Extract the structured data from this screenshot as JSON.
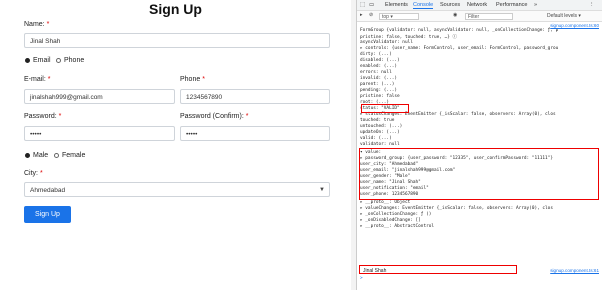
{
  "form": {
    "title": "Sign Up",
    "name_label": "Name:",
    "name_value": "Jinal Shah",
    "notify_email": "Email",
    "notify_phone": "Phone",
    "email_label": "E-mail:",
    "email_value": "jinalshah999@gmail.com",
    "phone_label": "Phone",
    "phone_value": "1234567890",
    "password_label": "Password:",
    "password_value": "•••••",
    "confirm_label": "Password (Confirm):",
    "confirm_value": "•••••",
    "gender_male": "Male",
    "gender_female": "Female",
    "city_label": "City:",
    "city_value": "Ahmedabad",
    "submit": "Sign Up",
    "required_mark": "*"
  },
  "devtools": {
    "tabs": [
      "Elements",
      "Console",
      "Sources",
      "Network",
      "Performance"
    ],
    "context": "top",
    "filter_placeholder": "Filter",
    "levels": "Default levels ▾",
    "lines": [
      {
        "text": "FormGroup {validator: null, asyncValidator: null, _onCollectionChange: ƒ, p",
        "src": "signup.component.ts:60"
      },
      {
        "text": "  pristine: false, touched: true, …} ⓘ",
        "src": ""
      },
      {
        "text": "  asyncValidator: null",
        "src": ""
      },
      {
        "text": "▸ controls: {user_name: FormControl, user_email: FormControl, password_grou",
        "src": ""
      },
      {
        "text": "  dirty: (...)",
        "src": ""
      },
      {
        "text": "  disabled: (...)",
        "src": ""
      },
      {
        "text": "  enabled: (...)",
        "src": ""
      },
      {
        "text": "  errors: null",
        "src": ""
      },
      {
        "text": "  invalid: (...)",
        "src": ""
      },
      {
        "text": "  parent: (...)",
        "src": ""
      },
      {
        "text": "  pending: (...)",
        "src": ""
      },
      {
        "text": "  pristine: false",
        "src": ""
      },
      {
        "text": "  root: (...)",
        "src": ""
      },
      {
        "text": "  status: \"VALID\"",
        "src": ""
      },
      {
        "text": "▸ statusChanges: EventEmitter {_isScalar: false, observers: Array(0), clos",
        "src": ""
      },
      {
        "text": "  touched: true",
        "src": ""
      },
      {
        "text": "  untouched: (...)",
        "src": ""
      },
      {
        "text": "  updateOn: (...)",
        "src": ""
      },
      {
        "text": "  valid: (...)",
        "src": ""
      },
      {
        "text": "  validator: null",
        "src": ""
      },
      {
        "text": "▾ value:",
        "src": ""
      },
      {
        "text": "  ▸ password_group: {user_password: \"12335\", user_confirmPassword: \"11111\"}",
        "src": ""
      },
      {
        "text": "    user_city: \"Ahmedabad\"",
        "src": ""
      },
      {
        "text": "    user_email: \"jinalshah999@gmail.com\"",
        "src": ""
      },
      {
        "text": "    user_gender: \"Male\"",
        "src": ""
      },
      {
        "text": "    user_name: \"Jinal Shah\"",
        "src": ""
      },
      {
        "text": "    user_notification: \"email\"",
        "src": ""
      },
      {
        "text": "    user_phone: 1234567890",
        "src": ""
      },
      {
        "text": "  ▸ __proto__: Object",
        "src": ""
      },
      {
        "text": "▸ valueChanges: EventEmitter {_isScalar: false, observers: Array(0), clos",
        "src": ""
      },
      {
        "text": "▸ _onCollectionChange: ƒ ()",
        "src": ""
      },
      {
        "text": "▸ _onDisabledChange: []",
        "src": ""
      },
      {
        "text": "▸ __proto__: AbstractControl",
        "src": ""
      }
    ],
    "log_name": "Jinal Shah",
    "log_src": "signup.component.ts:61",
    "prompt": ">"
  }
}
